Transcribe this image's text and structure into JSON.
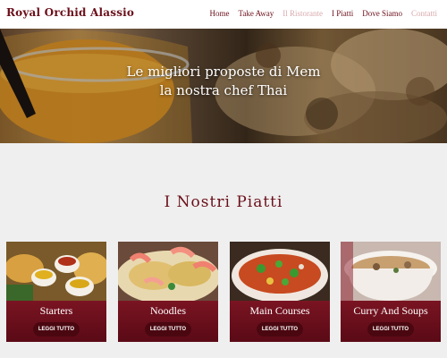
{
  "brand": {
    "name": "Royal Orchid Alassio"
  },
  "nav": {
    "items": [
      {
        "label": "Home"
      },
      {
        "label": "Take Away"
      },
      {
        "label": "Il Ristorante"
      },
      {
        "label": "I Piatti"
      },
      {
        "label": "Dove Siamo"
      },
      {
        "label": "Contatti"
      }
    ]
  },
  "hero": {
    "line1": "Le migliori proposte di Mem",
    "line2": "la nostra chef Thai"
  },
  "section": {
    "title": "I Nostri Piatti"
  },
  "cards": [
    {
      "title": "Starters",
      "button": "LEGGI TUTTO"
    },
    {
      "title": "Noodles",
      "button": "LEGGI TUTTO"
    },
    {
      "title": "Main Courses",
      "button": "LEGGI TUTTO"
    },
    {
      "title": "Curry And Soups",
      "button": "LEGGI TUTTO"
    }
  ],
  "colors": {
    "brand": "#6b0f1a",
    "nav_muted": "#d9a9ad",
    "card_band": "#6a0f1c",
    "page_bg": "#efefef"
  }
}
